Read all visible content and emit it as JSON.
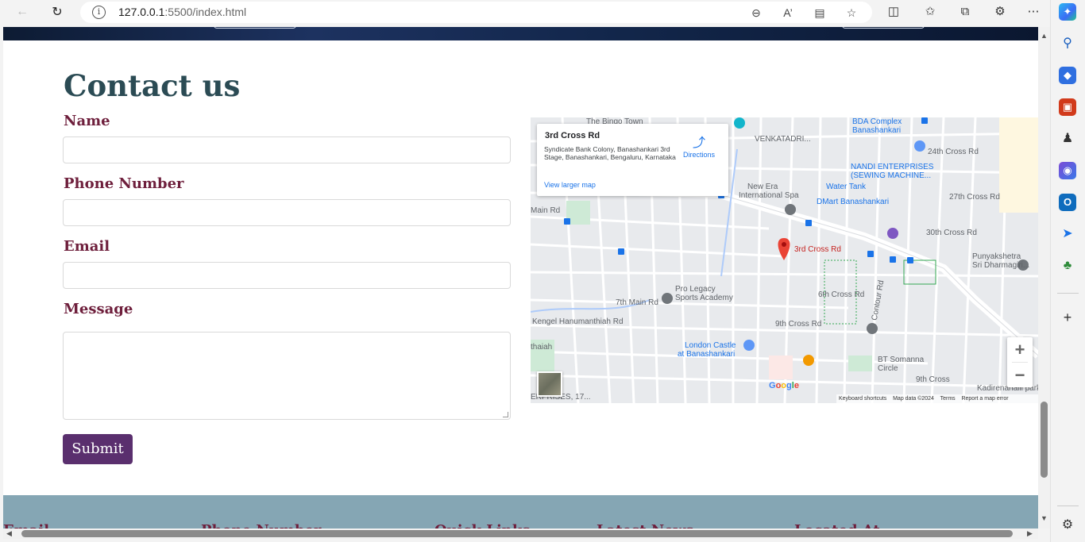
{
  "browser": {
    "url_host": "127.0.0.1",
    "url_rest": ":5500/index.html"
  },
  "page": {
    "title": "Contact us",
    "form": {
      "name_label": "Name",
      "phone_label": "Phone Number",
      "email_label": "Email",
      "message_label": "Message",
      "submit_label": "Submit"
    }
  },
  "map": {
    "place_name": "3rd Cross Rd",
    "place_address": "Syndicate Bank Colony, Banashankari 3rd Stage, Banashankari, Bengaluru, Karnataka",
    "directions_label": "Directions",
    "view_larger_label": "View larger map",
    "pin_label": "3rd Cross Rd",
    "labels": {
      "bda": "BDA Complex",
      "bda2": "Banashankari",
      "nandi": "NANDI ENTERPRISES",
      "nandi2": "(SEWING MACHINE...",
      "newera": "New Era",
      "newera2": "International Spa",
      "watertank": "Water Tank",
      "dmart": "DMart Banashankari",
      "punya": "Punyakshetra",
      "punya2": "Sri Dharmagiri...",
      "prolegacy": "Pro Legacy",
      "prolegacy2": "Sports Academy",
      "london": "London Castle",
      "london2": "at Banashankari",
      "kengel": "Kengel Hanumanthiah Rd",
      "bt": "BT Somanna",
      "bt2": "Circle",
      "kadirenahalli": "Kadirenahalli park",
      "venkatadri": "VENKATADRI...",
      "bingo": "The Bingo Town",
      "rd_24": "24th Cross Rd",
      "rd_27": "27th Cross Rd",
      "rd_30": "30th Cross Rd",
      "rd_6": "6th Cross Rd",
      "rd_9": "9th Cross Rd",
      "rd_9b": "9th Cross",
      "rd_7main": "7th Main Rd",
      "rd_main": "Main Rd",
      "contour": "Contour Rd",
      "thaiah": "thaiah",
      "erprises": "ERPRISES, 17..."
    },
    "zoom_in": "+",
    "zoom_out": "−",
    "attribution": [
      "Keyboard shortcuts",
      "Map data ©2024",
      "Terms",
      "Report a map error"
    ],
    "google": "Google"
  },
  "footer": {
    "headings": [
      "Email",
      "Phone Number",
      "Quick Links",
      "Latest News",
      "Located At"
    ]
  },
  "colors": {
    "title": "#2b4b54",
    "label": "#6e1f3c",
    "submit_bg": "#5a2f6e",
    "footer_bg": "#85a6b4"
  },
  "icons": [
    "back-icon",
    "refresh-icon",
    "info-icon",
    "zoom-out-icon",
    "read-aloud-icon",
    "immersive-reader-icon",
    "favorite-star-icon",
    "split-screen-icon",
    "favorites-icon",
    "collections-icon",
    "extensions-icon",
    "more-icon",
    "copilot-icon",
    "search-icon",
    "shopping-icon",
    "tools-icon",
    "games-icon",
    "office-icon",
    "outlook-icon",
    "send-icon",
    "tree-icon",
    "add-icon",
    "settings-icon"
  ]
}
